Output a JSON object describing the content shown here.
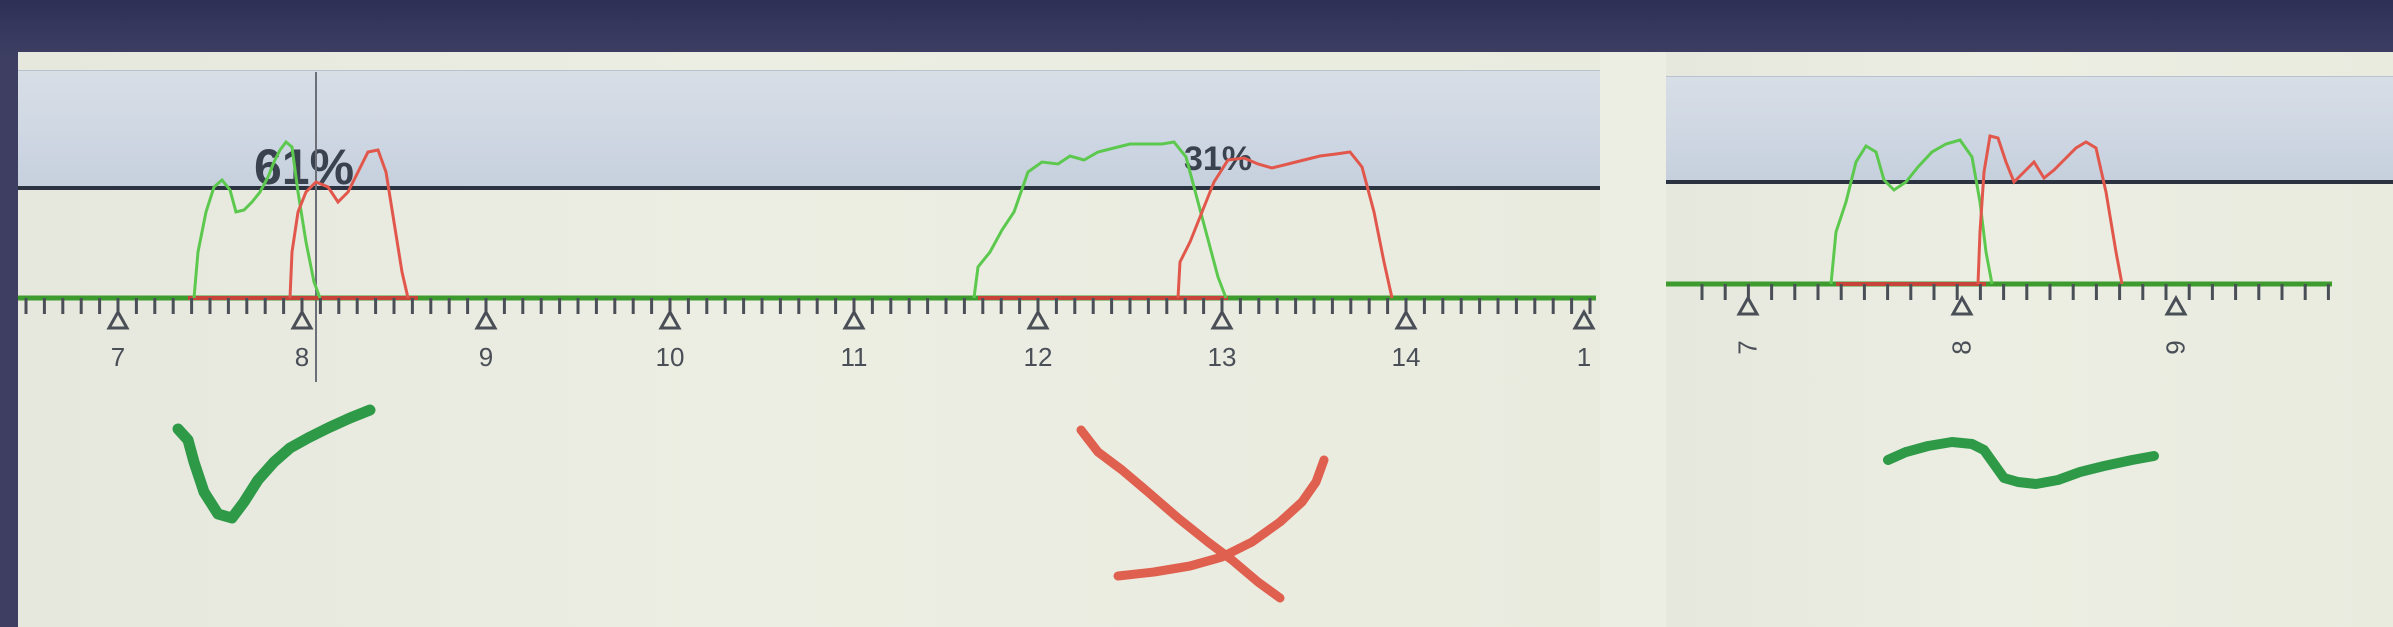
{
  "left_track": {
    "percent_a": "61%",
    "percent_b": "31%",
    "tick_labels": [
      "7",
      "8",
      "9",
      "10",
      "11",
      "12",
      "13",
      "14",
      "1"
    ]
  },
  "right_track": {
    "tick_labels": [
      "7",
      "8",
      "9"
    ]
  },
  "colors": {
    "green_trace": "#5cc94e",
    "red_trace": "#e2574c",
    "axis_green": "#3e9c2f",
    "marker_green": "#2e9a48",
    "marker_red": "#e0604f",
    "panel": "#eceee3",
    "header": "#cdd6e2"
  },
  "annotations": {
    "left": "check-mark",
    "middle": "cross-mark",
    "right": "tilde-mark"
  }
}
